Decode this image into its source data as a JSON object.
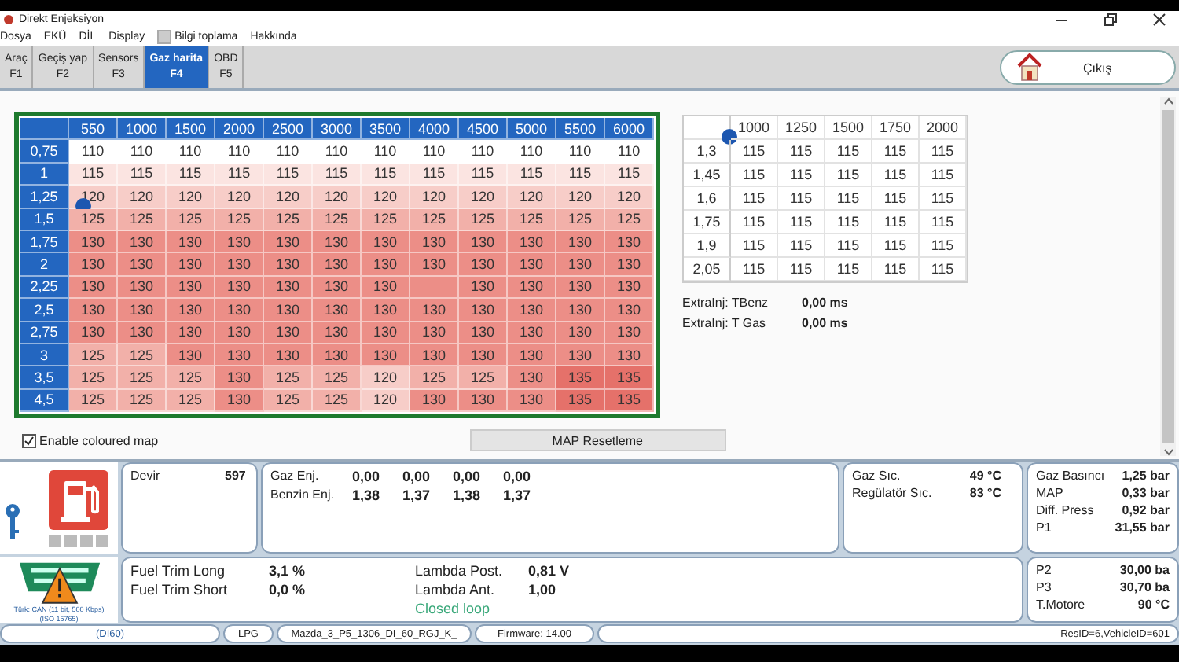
{
  "window": {
    "title": "Direkt Enjeksiyon"
  },
  "menu": [
    {
      "kind": "item",
      "label": "Dosya"
    },
    {
      "kind": "item",
      "label": "EKÜ"
    },
    {
      "kind": "item",
      "label": "DİL"
    },
    {
      "kind": "item",
      "label": "Display"
    },
    {
      "kind": "checkbox",
      "label": "Bilgi toplama",
      "checked": false
    },
    {
      "kind": "item",
      "label": "Hakkında"
    }
  ],
  "tabs": [
    {
      "label": "Araç",
      "key": "F1",
      "selected": false
    },
    {
      "label": "Geçiş yap",
      "key": "F2",
      "selected": false
    },
    {
      "label": "Sensors",
      "key": "F3",
      "selected": false
    },
    {
      "label": "Gaz harita",
      "key": "F4",
      "selected": true
    },
    {
      "label": "OBD",
      "key": "F5",
      "selected": false
    }
  ],
  "exit_button": {
    "label": "Çıkış"
  },
  "gas_map": {
    "columns": [
      "550",
      "1000",
      "1500",
      "2000",
      "2500",
      "3000",
      "3500",
      "4000",
      "4500",
      "5000",
      "5500",
      "6000"
    ],
    "rows": [
      {
        "label": "0,75",
        "marker": false,
        "cells": [
          "110",
          "110",
          "110",
          "110",
          "110",
          "110",
          "110",
          "110",
          "110",
          "110",
          "110",
          "110"
        ]
      },
      {
        "label": "1",
        "marker": false,
        "cells": [
          "115",
          "115",
          "115",
          "115",
          "115",
          "115",
          "115",
          "115",
          "115",
          "115",
          "115",
          "115"
        ]
      },
      {
        "label": "1,25",
        "marker": true,
        "cells": [
          "120",
          "120",
          "120",
          "120",
          "120",
          "120",
          "120",
          "120",
          "120",
          "120",
          "120",
          "120"
        ]
      },
      {
        "label": "1,5",
        "marker": false,
        "cells": [
          "125",
          "125",
          "125",
          "125",
          "125",
          "125",
          "125",
          "125",
          "125",
          "125",
          "125",
          "125"
        ]
      },
      {
        "label": "1,75",
        "marker": false,
        "cells": [
          "130",
          "130",
          "130",
          "130",
          "130",
          "130",
          "130",
          "130",
          "130",
          "130",
          "130",
          "130"
        ]
      },
      {
        "label": "2",
        "marker": false,
        "cells": [
          "130",
          "130",
          "130",
          "130",
          "130",
          "130",
          "130",
          "130",
          "130",
          "130",
          "130",
          "130"
        ]
      },
      {
        "label": "2,25",
        "marker": false,
        "cells": [
          "130",
          "130",
          "130",
          "130",
          "130",
          "130",
          "130",
          null,
          "130",
          "130",
          "130",
          "130"
        ]
      },
      {
        "label": "2,5",
        "marker": false,
        "cells": [
          "130",
          "130",
          "130",
          "130",
          "130",
          "130",
          "130",
          "130",
          "130",
          "130",
          "130",
          "130"
        ]
      },
      {
        "label": "2,75",
        "marker": false,
        "cells": [
          "130",
          "130",
          "130",
          "130",
          "130",
          "130",
          "130",
          "130",
          "130",
          "130",
          "130",
          "130"
        ]
      },
      {
        "label": "3",
        "marker": false,
        "cells": [
          "125",
          "125",
          "130",
          "130",
          "130",
          "130",
          "130",
          "130",
          "130",
          "130",
          "130",
          "130"
        ]
      },
      {
        "label": "3,5",
        "marker": false,
        "cells": [
          "125",
          "125",
          "125",
          "130",
          "125",
          "125",
          "120",
          "125",
          "125",
          "130",
          "135",
          "135"
        ]
      },
      {
        "label": "4,5",
        "marker": false,
        "cells": [
          "125",
          "125",
          "125",
          "130",
          "125",
          "125",
          "120",
          "130",
          "130",
          "130",
          "135",
          "135"
        ]
      }
    ]
  },
  "small_map": {
    "corner_marker": true,
    "columns": [
      "1000",
      "1250",
      "1500",
      "1750",
      "2000"
    ],
    "rows": [
      {
        "label": "1,3",
        "cells": [
          "115",
          "115",
          "115",
          "115",
          "115"
        ]
      },
      {
        "label": "1,45",
        "cells": [
          "115",
          "115",
          "115",
          "115",
          "115"
        ]
      },
      {
        "label": "1,6",
        "cells": [
          "115",
          "115",
          "115",
          "115",
          "115"
        ]
      },
      {
        "label": "1,75",
        "cells": [
          "115",
          "115",
          "115",
          "115",
          "115"
        ]
      },
      {
        "label": "1,9",
        "cells": [
          "115",
          "115",
          "115",
          "115",
          "115"
        ]
      },
      {
        "label": "2,05",
        "cells": [
          "115",
          "115",
          "115",
          "115",
          "115"
        ]
      }
    ]
  },
  "extra_inj": [
    {
      "label": "ExtraInj: TBenz",
      "value": "0,00 ms"
    },
    {
      "label": "ExtraInj: T Gas",
      "value": "0,00 ms"
    }
  ],
  "coloured_map": {
    "label": "Enable coloured map",
    "checked": true
  },
  "reset_button": {
    "label": "MAP Resetleme"
  },
  "can_info": "Türk: CAN (11 bit, 500 Kbps) (ISO 15765)",
  "rpm": {
    "label": "Devir",
    "value": "597"
  },
  "injectors": [
    {
      "label": "Gaz Enj.",
      "values": [
        "0,00",
        "0,00",
        "0,00",
        "0,00"
      ]
    },
    {
      "label": "Benzin Enj.",
      "values": [
        "1,38",
        "1,37",
        "1,38",
        "1,37"
      ]
    }
  ],
  "temperatures": [
    {
      "label": "Gaz Sıc.",
      "value": "49 °C"
    },
    {
      "label": "Regülatör Sıc.",
      "value": "83 °C"
    }
  ],
  "pressures": [
    {
      "label": "Gaz Basıncı",
      "value": "1,25 bar"
    },
    {
      "label": "MAP",
      "value": "0,33 bar"
    },
    {
      "label": "Diff. Press",
      "value": "0,92 bar"
    },
    {
      "label": "P1",
      "value": "31,55 bar"
    }
  ],
  "pressures_2": [
    {
      "label": "P2",
      "value": "30,00 ba"
    },
    {
      "label": "P3",
      "value": "30,70 ba"
    },
    {
      "label": "T.Motore",
      "value": "90 °C"
    }
  ],
  "fuel_trim": [
    {
      "label": "Fuel Trim Long",
      "value": "3,1 %"
    },
    {
      "label": "Fuel Trim Short",
      "value": "0,0 %"
    }
  ],
  "lambda": [
    {
      "label": "Lambda Post.",
      "value": "0,81 V"
    },
    {
      "label": "Lambda Ant.",
      "value": "1,00"
    }
  ],
  "loop_status": "Closed loop",
  "status_bar": [
    "(DI60)",
    "LPG",
    "Mazda_3_P5_1306_DI_60_RGJ_K_",
    "Firmware: 14.00",
    "ResID=6,VehicleID=601"
  ]
}
